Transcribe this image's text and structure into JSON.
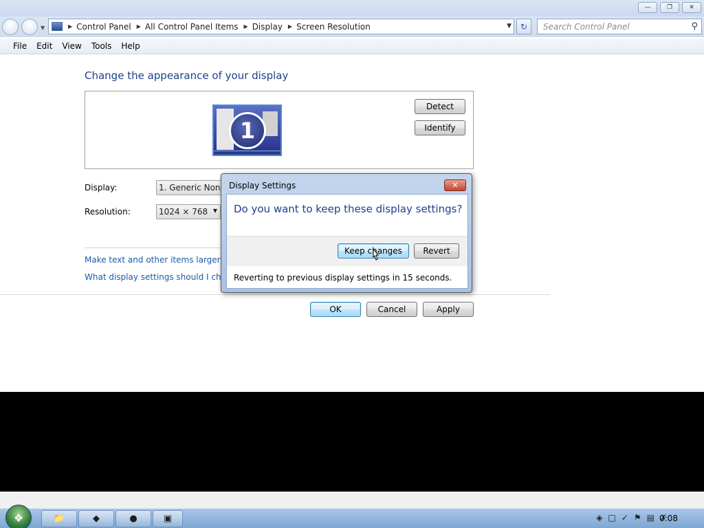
{
  "breadcrumb": [
    "Control Panel",
    "All Control Panel Items",
    "Display",
    "Screen Resolution"
  ],
  "search": {
    "placeholder": "Search Control Panel"
  },
  "menu": [
    "File",
    "Edit",
    "View",
    "Tools",
    "Help"
  ],
  "page": {
    "heading": "Change the appearance of your display",
    "detect_label": "Detect",
    "identify_label": "Identify",
    "monitor_number": "1",
    "display_label": "Display:",
    "display_value": "1. Generic Non-P",
    "resolution_label": "Resolution:",
    "resolution_value": "1024 × 768",
    "link_text_size": "Make text and other items larger or sm",
    "link_settings_help": "What display settings should I choose",
    "ok_label": "OK",
    "cancel_label": "Cancel",
    "apply_label": "Apply"
  },
  "dialog": {
    "title": "Display Settings",
    "question": "Do you want to keep these display settings?",
    "keep_label": "Keep changes",
    "revert_label": "Revert",
    "countdown": "Reverting to previous display settings in 15 seconds."
  },
  "taskbar": {
    "clock": "0:08"
  },
  "colors": {
    "accent": "#1e3f87",
    "link": "#1e5aa8"
  },
  "icons": [
    "back-icon",
    "forward-icon",
    "control-panel-icon",
    "refresh-icon",
    "search-icon",
    "close-icon",
    "start-icon"
  ]
}
